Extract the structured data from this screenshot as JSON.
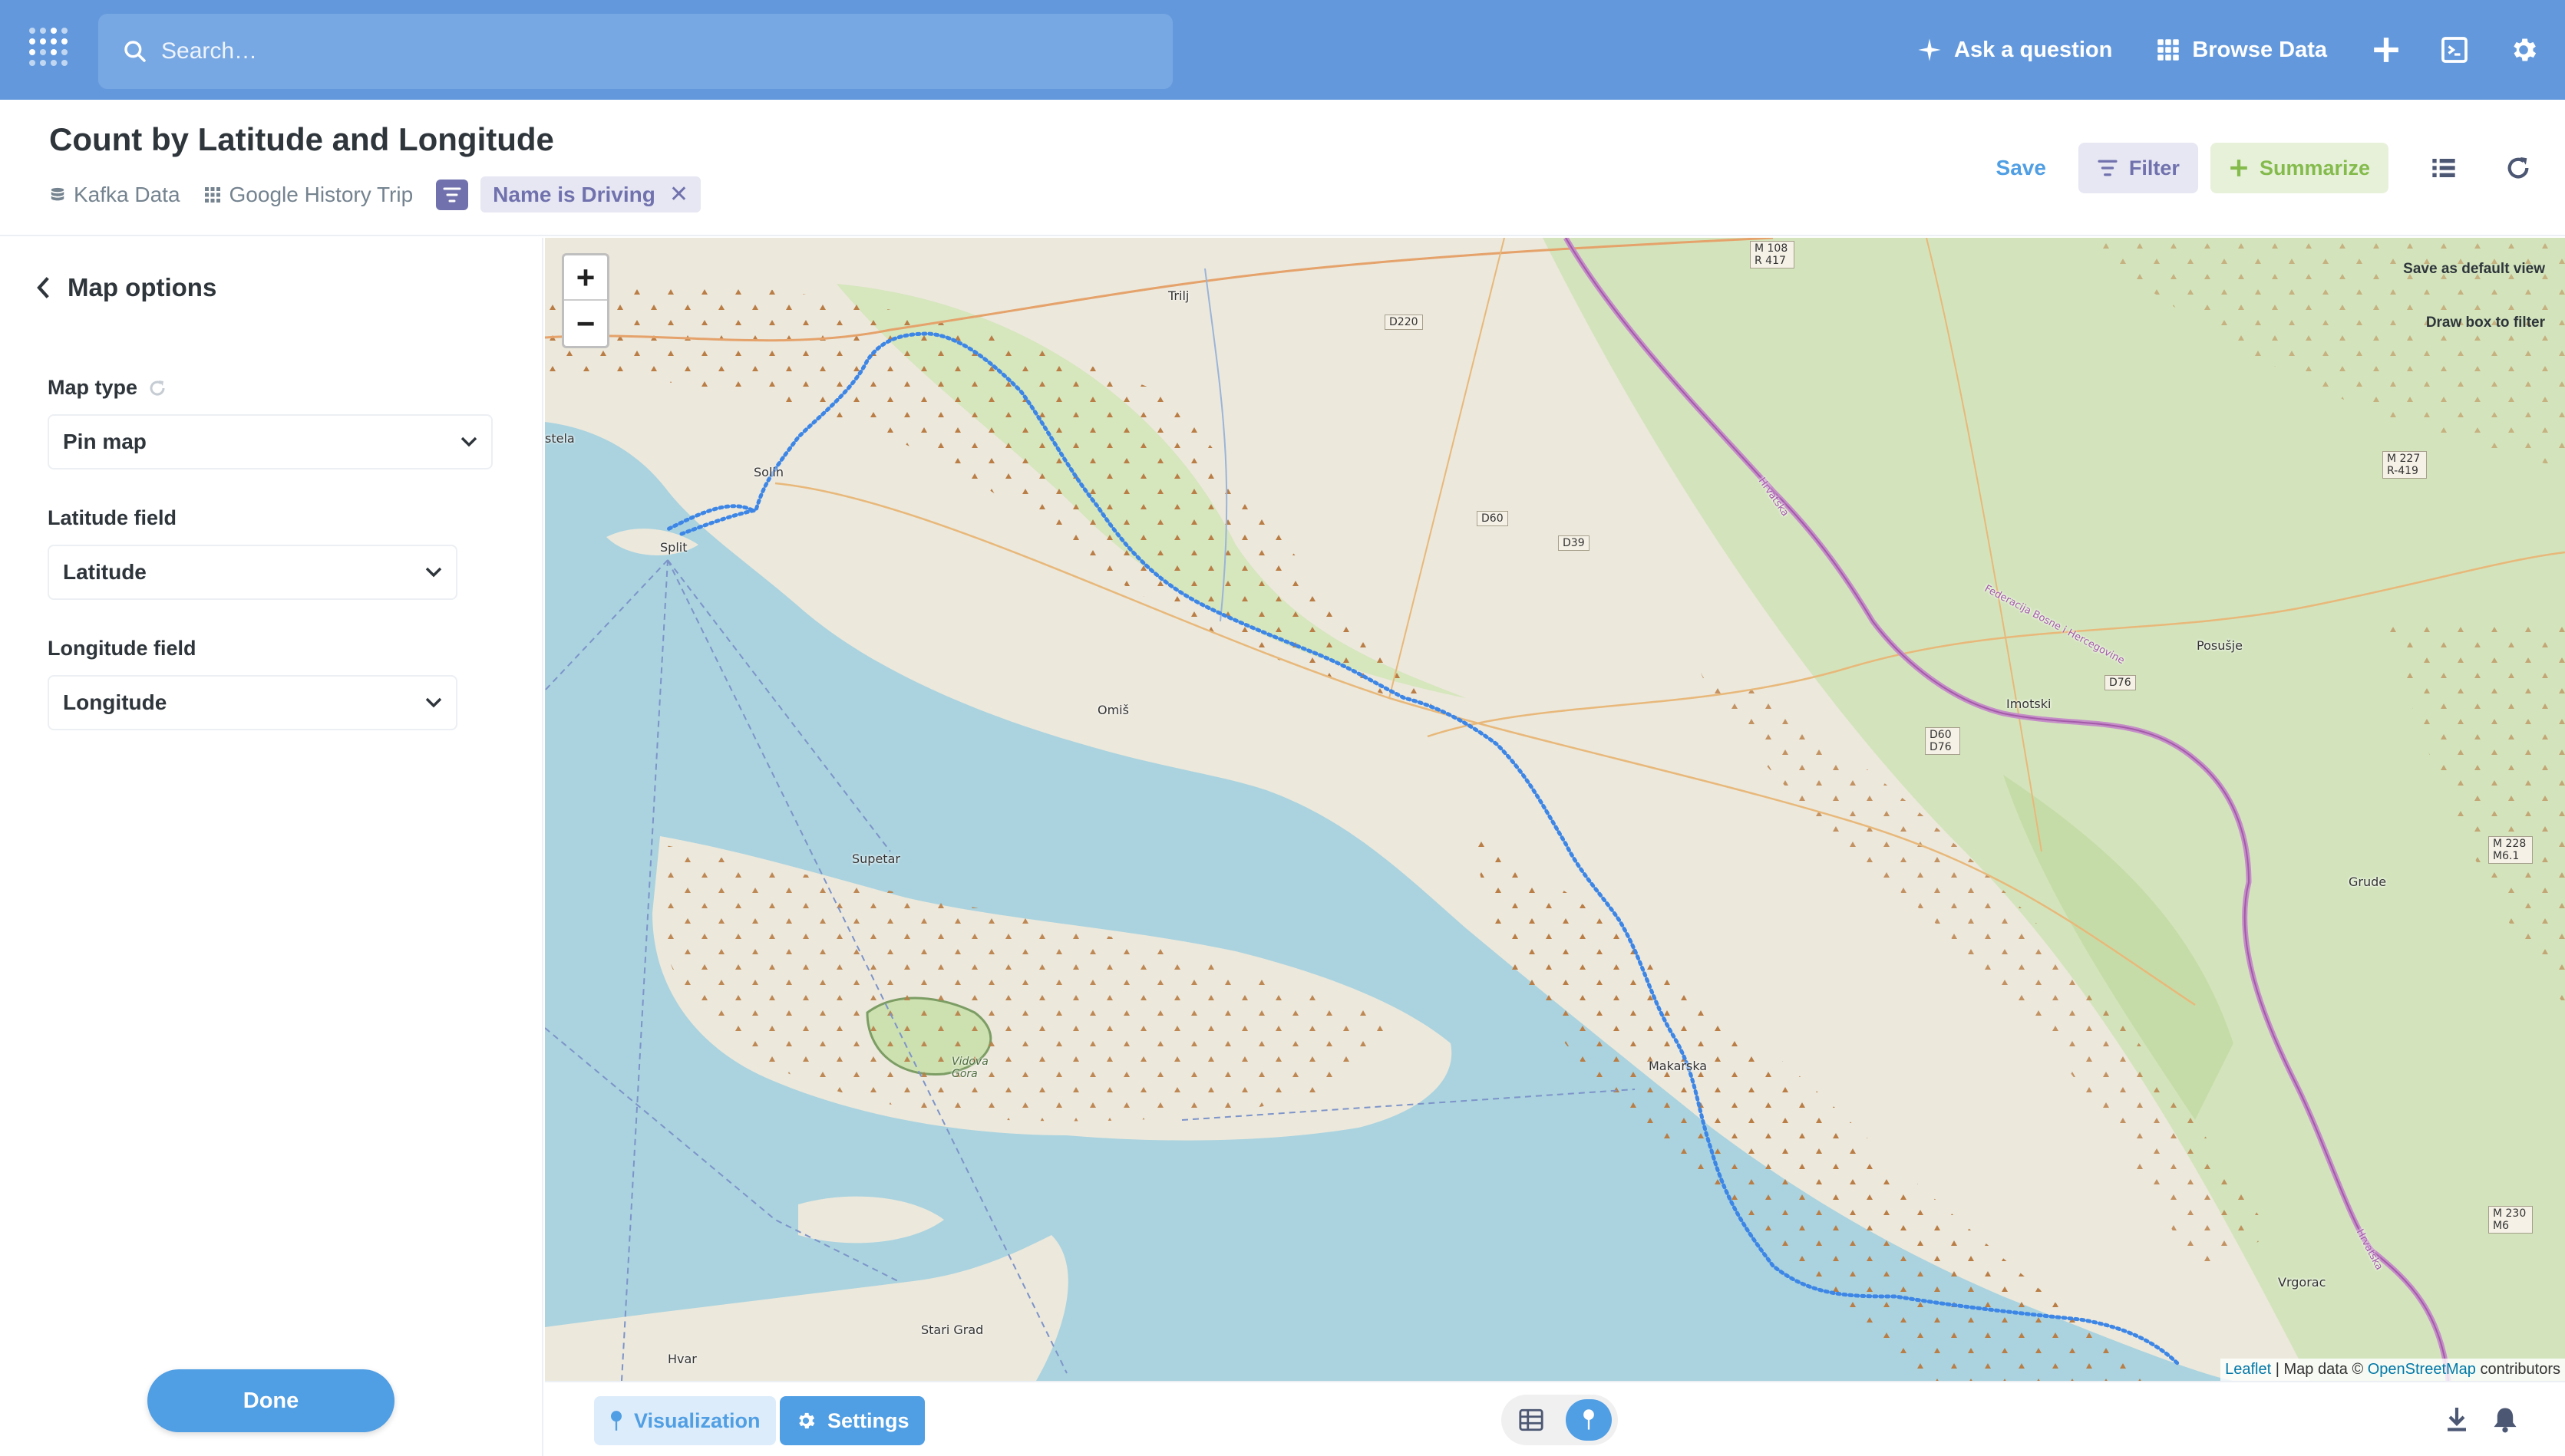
{
  "nav": {
    "search_placeholder": "Search…",
    "ask_label": "Ask a question",
    "browse_label": "Browse Data"
  },
  "header": {
    "title": "Count by Latitude and Longitude",
    "crumbs": [
      "Kafka Data",
      "Google History Trip"
    ],
    "filter_pill": "Name is Driving",
    "save_label": "Save",
    "filter_label": "Filter",
    "summarize_label": "Summarize"
  },
  "sidebar": {
    "title": "Map options",
    "map_type_label": "Map type",
    "map_type_value": "Pin map",
    "latitude_label": "Latitude field",
    "latitude_value": "Latitude",
    "longitude_label": "Longitude field",
    "longitude_value": "Longitude",
    "done_label": "Done"
  },
  "map": {
    "save_default": "Save as default view",
    "draw_box": "Draw box to filter",
    "attribution_leaflet": "Leaflet",
    "attribution_mid": " | Map data © ",
    "attribution_osm": "OpenStreetMap",
    "attribution_end": " contributors",
    "places": {
      "trilj": "Trilj",
      "split": "Split",
      "solin": "Solin",
      "omis": "Omiš",
      "supetar": "Supetar",
      "vidova": "Vidova Gora",
      "makarska": "Makarska",
      "imotski": "Imotski",
      "posusje": "Posušje",
      "grude": "Grude",
      "vrgorac": "Vrgorac",
      "hvar": "Hvar",
      "starigrad": "Stari Grad",
      "stela": "stela",
      "fbih": "Federacija Bosne i Hercegovine",
      "hrvatska": "Hrvatska"
    },
    "shields": {
      "m108": "M 108 R 417",
      "d220": "D220",
      "d60": "D60",
      "d39": "D39",
      "d76": "D76",
      "d60d76": "D60 D76",
      "m227": "M 227 R-419",
      "m228": "M 228 M6.1",
      "m230": "M 230 M6"
    }
  },
  "footer": {
    "visualization_label": "Visualization",
    "settings_label": "Settings"
  },
  "colors": {
    "brand": "#509ee3",
    "nav_bg": "#6399dc",
    "filter": "#7172ad",
    "summarize": "#84bb4c",
    "sea": "#aad3df",
    "route": "#3d86e6"
  }
}
